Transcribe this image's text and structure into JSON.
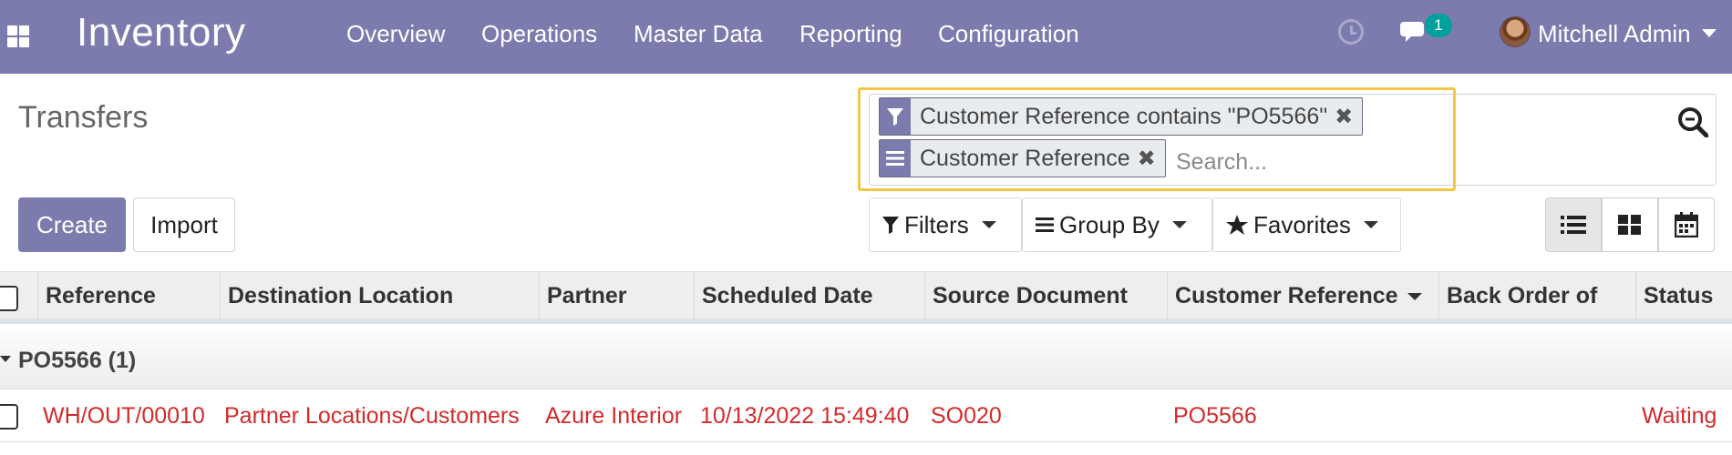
{
  "topbar": {
    "app_name": "Inventory",
    "menu": [
      "Overview",
      "Operations",
      "Master Data",
      "Reporting",
      "Configuration"
    ],
    "chat_badge": "1",
    "user_name": "Mitchell Admin"
  },
  "control_panel": {
    "title": "Transfers",
    "search": {
      "facets": [
        {
          "kind": "filter",
          "label": "Customer Reference contains \"PO5566\""
        },
        {
          "kind": "group",
          "label": "Customer Reference"
        }
      ],
      "placeholder": "Search..."
    },
    "buttons": {
      "create": "Create",
      "import": "Import"
    },
    "dropdowns": {
      "filters": "Filters",
      "group_by": "Group By",
      "favorites": "Favorites"
    }
  },
  "table": {
    "columns": [
      "Reference",
      "Destination Location",
      "Partner",
      "Scheduled Date",
      "Source Document",
      "Customer Reference",
      "Back Order of",
      "Status"
    ],
    "group": {
      "label": "PO5566 (1)"
    },
    "rows": [
      {
        "reference": "WH/OUT/00010",
        "destination": "Partner Locations/Customers",
        "partner": "Azure Interior",
        "scheduled_date": "10/13/2022 15:49:40",
        "source_document": "SO020",
        "customer_reference": "PO5566",
        "back_order_of": "",
        "status": "Waiting"
      }
    ]
  },
  "colors": {
    "brand": "#7c7bad",
    "row_text": "#d12b2b",
    "focus": "#f2c744",
    "badge": "#00a09d"
  }
}
